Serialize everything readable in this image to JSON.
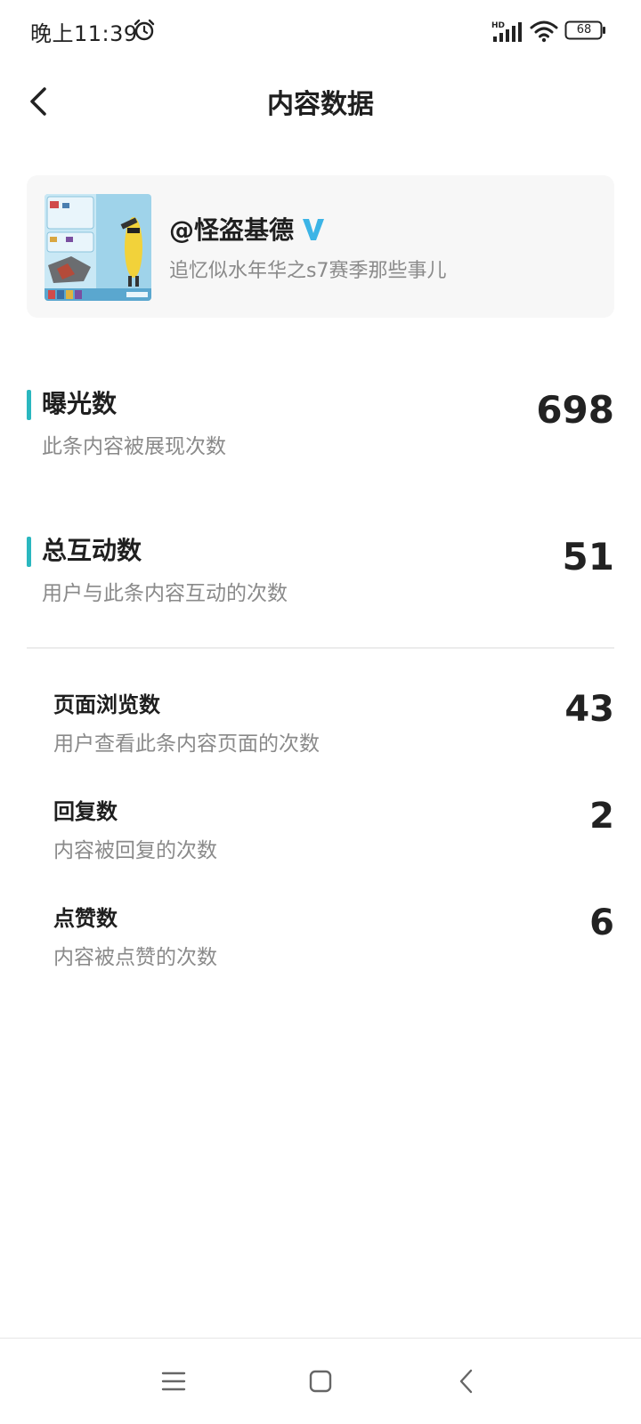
{
  "status_bar": {
    "time": "晚上11:39",
    "battery": "68",
    "icons": [
      "alarm-icon",
      "signal-hd-icon",
      "wifi-icon",
      "battery-icon"
    ]
  },
  "header": {
    "title": "内容数据",
    "back_icon": "chevron-left-icon"
  },
  "content_card": {
    "author": "@怪盗基德",
    "verified_icon": "verified-v-icon",
    "description": "追忆似水年华之s7赛季那些事儿"
  },
  "metrics": {
    "exposure": {
      "title": "曝光数",
      "desc": "此条内容被展现次数",
      "value": "698"
    },
    "interaction": {
      "title": "总互动数",
      "desc": "用户与此条内容互动的次数",
      "value": "51"
    }
  },
  "sub_metrics": [
    {
      "title": "页面浏览数",
      "desc": "用户查看此条内容页面的次数",
      "value": "43"
    },
    {
      "title": "回复数",
      "desc": "内容被回复的次数",
      "value": "2"
    },
    {
      "title": "点赞数",
      "desc": "内容被点赞的次数",
      "value": "6"
    }
  ],
  "nav_bar": {
    "icons": [
      "menu-icon",
      "home-square-icon",
      "back-triangle-icon"
    ]
  },
  "colors": {
    "accent": "#2ab7bf",
    "verified": "#3cb4e6",
    "muted_text": "#8a8a8a"
  }
}
